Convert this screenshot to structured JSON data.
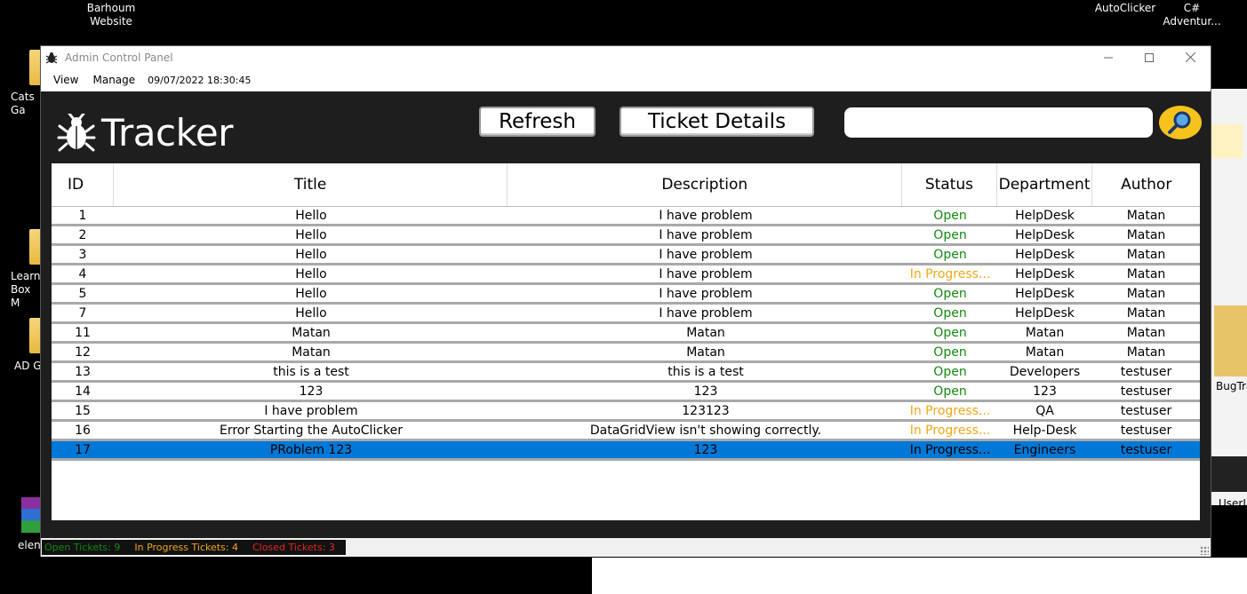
{
  "desktop": {
    "icons_top": [
      {
        "label": "Barhoum\nWebsite"
      },
      {
        "label": "AutoClicker"
      },
      {
        "label": "C#\nAdventur..."
      }
    ],
    "left_labels": [
      "Cats\nGa",
      "Learn\nBox M",
      "AD G",
      "elen"
    ],
    "right_labels": [
      "BugTra",
      "UserLo"
    ]
  },
  "window": {
    "title": "Admin Control Panel",
    "menu": [
      "View",
      "Manage"
    ],
    "timestamp": "09/07/2022 18:30:45",
    "controls": [
      "minimize",
      "maximize",
      "close"
    ]
  },
  "header": {
    "logo_text": "Tracker",
    "refresh_label": "Refresh",
    "details_label": "Ticket Details",
    "search_value": ""
  },
  "grid": {
    "columns": [
      "ID",
      "Title",
      "Description",
      "Status",
      "Department",
      "Author"
    ],
    "rows": [
      {
        "id": "1",
        "title": "Hello",
        "description": "I have problem",
        "status": "Open",
        "department": "HelpDesk",
        "author": "Matan"
      },
      {
        "id": "2",
        "title": "Hello",
        "description": "I have problem",
        "status": "Open",
        "department": "HelpDesk",
        "author": "Matan"
      },
      {
        "id": "3",
        "title": "Hello",
        "description": "I have problem",
        "status": "Open",
        "department": "HelpDesk",
        "author": "Matan"
      },
      {
        "id": "4",
        "title": "Hello",
        "description": "I have problem",
        "status": "In Progress...",
        "department": "HelpDesk",
        "author": "Matan"
      },
      {
        "id": "5",
        "title": "Hello",
        "description": "I have problem",
        "status": "Open",
        "department": "HelpDesk",
        "author": "Matan"
      },
      {
        "id": "7",
        "title": "Hello",
        "description": "I have problem",
        "status": "Open",
        "department": "HelpDesk",
        "author": "Matan"
      },
      {
        "id": "11",
        "title": "Matan",
        "description": "Matan",
        "status": "Open",
        "department": "Matan",
        "author": "Matan"
      },
      {
        "id": "12",
        "title": "Matan",
        "description": "Matan",
        "status": "Open",
        "department": "Matan",
        "author": "Matan"
      },
      {
        "id": "13",
        "title": "this is a test",
        "description": "this is a test",
        "status": "Open",
        "department": "Developers",
        "author": "testuser"
      },
      {
        "id": "14",
        "title": "123",
        "description": "123",
        "status": "Open",
        "department": "123",
        "author": "testuser"
      },
      {
        "id": "15",
        "title": "I have problem",
        "description": "123123",
        "status": "In Progress...",
        "department": "QA",
        "author": "testuser"
      },
      {
        "id": "16",
        "title": "Error Starting the AutoClicker",
        "description": "DataGridView isn't showing correctly.",
        "status": "In Progress...",
        "department": "Help-Desk",
        "author": "testuser"
      },
      {
        "id": "17",
        "title": "PRoblem 123",
        "description": "123",
        "status": "In Progress...",
        "department": "Engineers",
        "author": "testuser",
        "selected": true
      }
    ]
  },
  "statusbar": {
    "open": "Open Tickets: 9",
    "in_progress": "In Progress Tickets: 4",
    "closed": "Closed Tickets: 3"
  },
  "colors": {
    "open": "#118a11",
    "in_progress": "#f0a818",
    "closed": "#e0281e",
    "selection": "#0078d7",
    "search_button": "#f7c21c"
  }
}
